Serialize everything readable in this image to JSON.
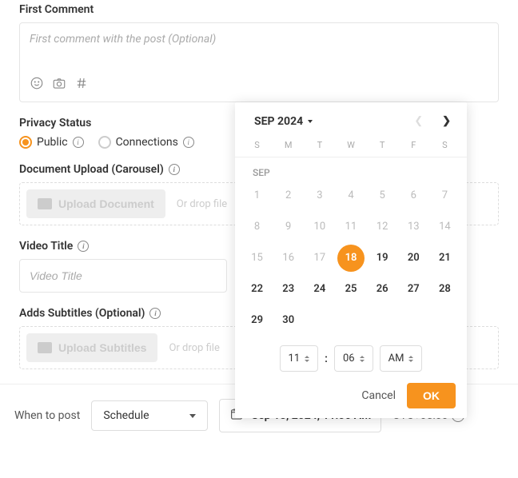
{
  "firstComment": {
    "label": "First Comment",
    "placeholder": "First comment with the post (Optional)"
  },
  "privacy": {
    "label": "Privacy Status",
    "options": [
      {
        "label": "Public",
        "checked": true
      },
      {
        "label": "Connections",
        "checked": false
      }
    ]
  },
  "docUpload": {
    "label": "Document Upload (Carousel)",
    "button": "Upload Document",
    "drop": "Or drop file"
  },
  "videoTitle": {
    "label": "Video Title",
    "placeholder": "Video Title"
  },
  "subtitles": {
    "label": "Adds Subtitles (Optional)",
    "button": "Upload Subtitles",
    "drop": "Or drop file"
  },
  "footer": {
    "whenLabel": "When to post",
    "scheduleLabel": "Schedule",
    "dateText": "Sep 18, 2024, 11:06 AM",
    "utc": "UTC+05:00"
  },
  "datepicker": {
    "monthLabel": "SEP 2024",
    "monthShort": "SEP",
    "weekdays": [
      "S",
      "M",
      "T",
      "W",
      "T",
      "F",
      "S"
    ],
    "days": [
      {
        "n": "1",
        "muted": true
      },
      {
        "n": "2",
        "muted": true
      },
      {
        "n": "3",
        "muted": true
      },
      {
        "n": "4",
        "muted": true
      },
      {
        "n": "5",
        "muted": true
      },
      {
        "n": "6",
        "muted": true
      },
      {
        "n": "7",
        "muted": true
      },
      {
        "n": "8",
        "muted": true
      },
      {
        "n": "9",
        "muted": true
      },
      {
        "n": "10",
        "muted": true
      },
      {
        "n": "11",
        "muted": true
      },
      {
        "n": "12",
        "muted": true
      },
      {
        "n": "13",
        "muted": true
      },
      {
        "n": "14",
        "muted": true
      },
      {
        "n": "15",
        "muted": true
      },
      {
        "n": "16",
        "muted": true
      },
      {
        "n": "17",
        "muted": true
      },
      {
        "n": "18",
        "selected": true,
        "bold": true
      },
      {
        "n": "19",
        "bold": true
      },
      {
        "n": "20",
        "bold": true
      },
      {
        "n": "21",
        "bold": true
      },
      {
        "n": "22",
        "bold": true
      },
      {
        "n": "23",
        "bold": true
      },
      {
        "n": "24",
        "bold": true
      },
      {
        "n": "25",
        "bold": true
      },
      {
        "n": "26",
        "bold": true
      },
      {
        "n": "27",
        "bold": true
      },
      {
        "n": "28",
        "bold": true
      },
      {
        "n": "29",
        "bold": true
      },
      {
        "n": "30",
        "bold": true
      }
    ],
    "hour": "11",
    "minute": "06",
    "ampm": "AM",
    "cancel": "Cancel",
    "ok": "OK"
  }
}
